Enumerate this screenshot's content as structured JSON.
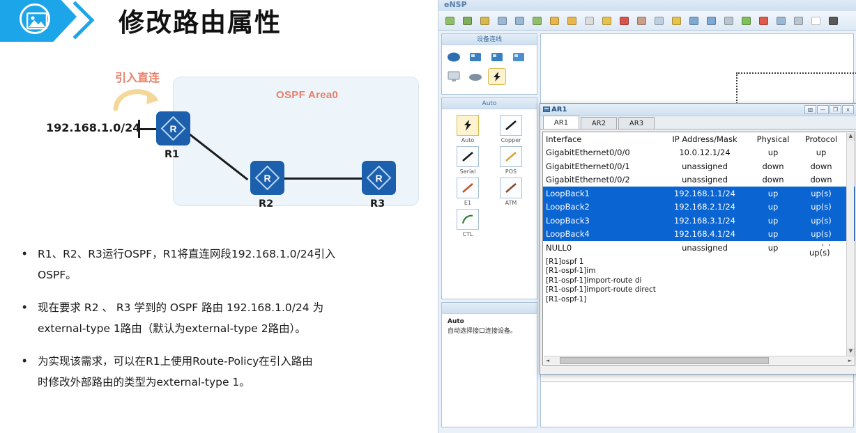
{
  "slide": {
    "header": {
      "title": "修改路由属性",
      "icon": "image-icon",
      "accent_color": "#1ca5e8"
    },
    "diagram": {
      "import_label": "引入直连",
      "area_label": "OSPF Area0",
      "network_label": "192.168.1.0/24",
      "routers": [
        {
          "name": "R1"
        },
        {
          "name": "R2"
        },
        {
          "name": "R3"
        }
      ],
      "accent_color": "#e8806a",
      "router_color": "#1b5fad"
    },
    "bullets": [
      {
        "marker": "•",
        "lines": [
          "R1、R2、R3运行OSPF，R1将直连网段192.168.1.0/24引入",
          "OSPF。"
        ]
      },
      {
        "marker": "•",
        "lines": [
          "现在要求 R2 、 R3 学到的 OSPF 路由 192.168.1.0/24 为",
          "external-type 1路由（默认为external-type 2路由）。"
        ]
      },
      {
        "marker": "•",
        "lines": [
          "为实现该需求，可以在R1上使用Route-Policy在引入路由",
          "时修改外部路由的类型为external-type 1。"
        ]
      }
    ]
  },
  "ensp": {
    "title": "eNSP",
    "toolbar_icons": [
      "new-topology-icon",
      "open-file-icon",
      "save-icon",
      "save-as-icon",
      "print-icon",
      "cut-icon",
      "undo-icon",
      "redo-icon",
      "pointer-icon",
      "lightbulb-icon",
      "delete-icon",
      "edit-icon",
      "comment-icon",
      "note-icon",
      "zoom-in-icon",
      "zoom-out-icon",
      "grid-icon",
      "start-all-icon",
      "stop-all-icon",
      "capture-icon",
      "select-icon",
      "rect-icon",
      "restore-icon"
    ],
    "device_panel": {
      "header": "设备连线",
      "devices": [
        "router-icon",
        "switch-icon",
        "switch-l3-icon",
        "wlan-icon",
        "pc-icon",
        "cloud-icon",
        "connection-icon"
      ],
      "selected": "connection-icon"
    },
    "cable_panel": {
      "header": "Auto",
      "cables": [
        {
          "label": "Auto",
          "icon": "auto-cable-icon",
          "selected": true
        },
        {
          "label": "Copper",
          "icon": "copper-cable-icon",
          "selected": false
        },
        {
          "label": "Serial",
          "icon": "serial-cable-icon",
          "selected": false
        },
        {
          "label": "POS",
          "icon": "pos-cable-icon",
          "selected": false
        },
        {
          "label": "E1",
          "icon": "e1-cable-icon",
          "selected": false
        },
        {
          "label": "ATM",
          "icon": "atm-cable-icon",
          "selected": false
        },
        {
          "label": "CTL",
          "icon": "ctl-cable-icon",
          "selected": false
        }
      ]
    },
    "tip_panel": {
      "title": "Auto",
      "body": "自动选择接口连接设备。"
    },
    "ar1_window": {
      "title": "AR1",
      "buttons": [
        "pin",
        "minimize",
        "maximize",
        "close"
      ],
      "button_glyphs": [
        "▥",
        "—",
        "❐",
        "x"
      ],
      "tabs": [
        {
          "label": "AR1",
          "active": true
        },
        {
          "label": "AR2",
          "active": false
        },
        {
          "label": "AR3",
          "active": false
        }
      ],
      "table": {
        "columns": [
          "Interface",
          "IP Address/Mask",
          "Physical",
          "Protocol"
        ],
        "rows": [
          {
            "interface": "GigabitEthernet0/0/0",
            "ip": "10.0.12.1/24",
            "physical": "up",
            "protocol": "up",
            "selected": false
          },
          {
            "interface": "GigabitEthernet0/0/1",
            "ip": "unassigned",
            "physical": "down",
            "protocol": "down",
            "selected": false
          },
          {
            "interface": "GigabitEthernet0/0/2",
            "ip": "unassigned",
            "physical": "down",
            "protocol": "down",
            "selected": false
          },
          {
            "interface": "LoopBack1",
            "ip": "192.168.1.1/24",
            "physical": "up",
            "protocol": "up(s)",
            "selected": true
          },
          {
            "interface": "LoopBack2",
            "ip": "192.168.2.1/24",
            "physical": "up",
            "protocol": "up(s)",
            "selected": true
          },
          {
            "interface": "LoopBack3",
            "ip": "192.168.3.1/24",
            "physical": "up",
            "protocol": "up(s)",
            "selected": true
          },
          {
            "interface": "LoopBack4",
            "ip": "192.168.4.1/24",
            "physical": "up",
            "protocol": "up(s)",
            "selected": true
          },
          {
            "interface": "NULL0",
            "ip": "unassigned",
            "physical": "up",
            "protocol": "up(s)",
            "selected": false
          }
        ],
        "selection_color": "#0a64d2",
        "overlay_text": "up(s)"
      },
      "cli_lines": [
        "[R1]ospf 1",
        "[R1-ospf-1]im",
        "[R1-ospf-1]import-route di",
        "[R1-ospf-1]import-route direct",
        "[R1-ospf-1]"
      ]
    }
  }
}
